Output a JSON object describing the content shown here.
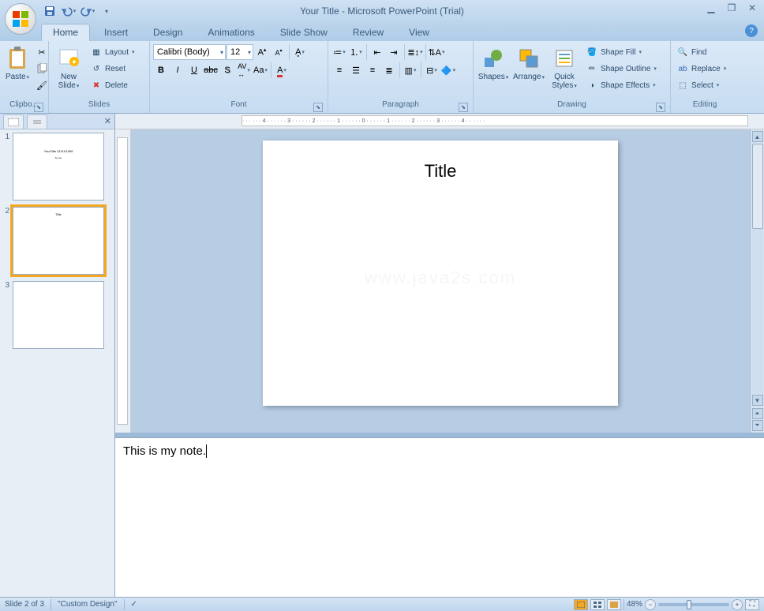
{
  "title": "Your Title - Microsoft PowerPoint (Trial)",
  "tabs": {
    "home": "Home",
    "insert": "Insert",
    "design": "Design",
    "animations": "Animations",
    "slideshow": "Slide Show",
    "review": "Review",
    "view": "View"
  },
  "ribbon": {
    "clipboard": {
      "label": "Clipbo...",
      "paste": "Paste"
    },
    "slides": {
      "label": "Slides",
      "newslide": "New\nSlide",
      "layout": "Layout",
      "reset": "Reset",
      "delete": "Delete"
    },
    "font": {
      "label": "Font",
      "family": "Calibri (Body)",
      "size": "12"
    },
    "paragraph": {
      "label": "Paragraph"
    },
    "drawing": {
      "label": "Drawing",
      "shapes": "Shapes",
      "arrange": "Arrange",
      "quick": "Quick\nStyles",
      "fill": "Shape Fill",
      "outline": "Shape Outline",
      "effects": "Shape Effects"
    },
    "editing": {
      "label": "Editing",
      "find": "Find",
      "replace": "Replace",
      "select": "Select"
    }
  },
  "thumbs": {
    "s1": {
      "num": "1",
      "line1": "YourTitle 01/01/1999",
      "line2": "by me"
    },
    "s2": {
      "num": "2",
      "line1": "Title"
    },
    "s3": {
      "num": "3"
    }
  },
  "canvas": {
    "title": "Title",
    "watermark": "www.java2s.com"
  },
  "ruler": {
    "ticks": "· · · · · · 4 · · · · · · 3 · · · · · · 2 · · · · · · 1 · · · · · · 0 · · · · · · 1 · · · · · · 2 · · · · · · 3 · · · · · · 4 · · · · · ·"
  },
  "notes": "This is my note.",
  "status": {
    "slide": "Slide 2 of 3",
    "design": "\"Custom Design\"",
    "zoom": "48%"
  }
}
